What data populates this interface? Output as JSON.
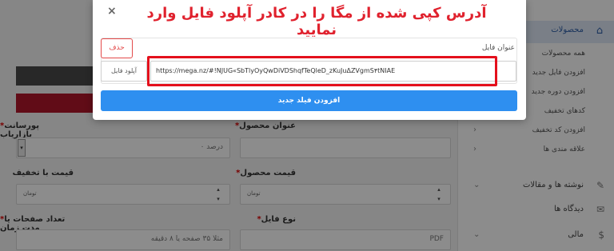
{
  "modal": {
    "title": "آدرس کپی شده از مگا را در کادر آپلود فایل وارد نمایید",
    "close_glyph": "×",
    "file_title_label": "عنوان فایل",
    "delete_label": "حذف",
    "upload_label": "آپلود فایل",
    "url_value": "https://mega.nz/#!NJUG«SbTlyOyQwDiVDShqfTeQleD_zKuJuΔZVgmS۴tNIAE",
    "add_field_label": "افزودن فیلد جدید"
  },
  "sidebar": {
    "header": {
      "label": "محصولات",
      "icon": "basket-icon"
    },
    "items": [
      {
        "label": "همه محصولات"
      },
      {
        "label": "افزودن فایل جدید"
      },
      {
        "label": "افزودن دوره جدید"
      },
      {
        "label": "کدهای تخفیف"
      },
      {
        "label": "افزودن کد تخفیف"
      },
      {
        "label": "علاقه مندی ها"
      }
    ],
    "sections": [
      {
        "label": "نوشته ها و مقالات",
        "icon": "pin-icon"
      },
      {
        "label": "دیدگاه ها",
        "icon": "comment-icon"
      },
      {
        "label": "مالی",
        "icon": "money-icon"
      }
    ],
    "item_chevron": "›"
  },
  "form": {
    "product_title_label": "عنوان محصول",
    "marketer_percent_label": "پورسانت بازاریاب",
    "marketer_percent_value": "۰ درصد",
    "price_label": "قیمت محصول",
    "discount_price_label": "قیمت با تخفیف",
    "currency": "تومان",
    "file_type_label": "نوع فایل",
    "file_type_value": "PDF",
    "pages_label": "تعداد صفحات یا مدت زمان",
    "pages_placeholder": "مثلا ۳۵ صفحه یا ۸ دقیقه",
    "required_mark": "*"
  },
  "colors": {
    "accent_blue": "#2e8ff0",
    "alert_red": "#e4101c",
    "delete_red": "#e34a4a"
  }
}
